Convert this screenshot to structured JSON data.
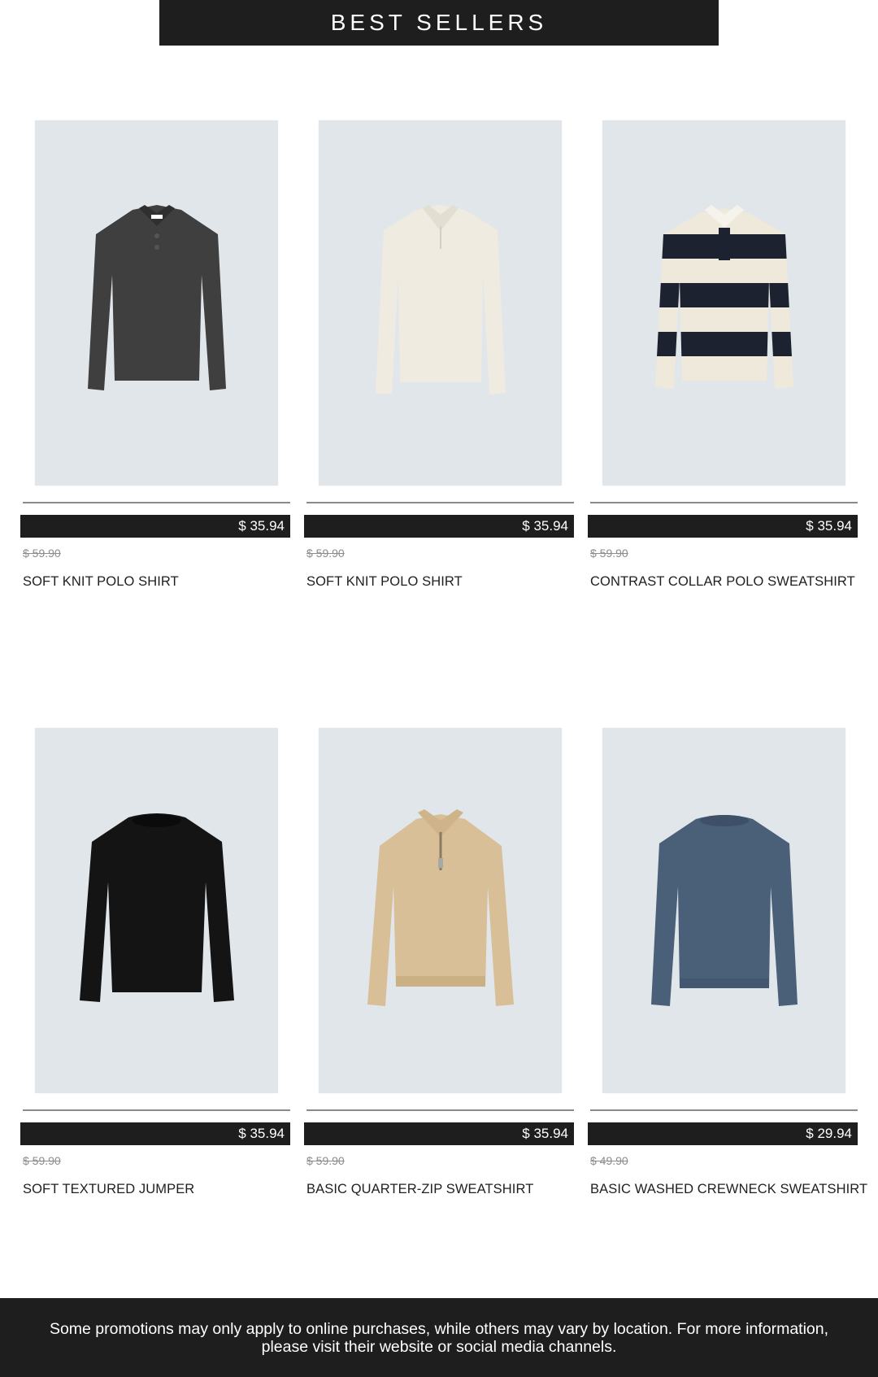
{
  "header": {
    "title": "BEST SELLERS"
  },
  "products": [
    {
      "price": "$ 35.94",
      "old_price": "$ 59.90",
      "name": "SOFT KNIT POLO SHIRT",
      "image": "knit-polo-charcoal",
      "color": "#3f3f3f"
    },
    {
      "price": "$ 35.94",
      "old_price": "$ 59.90",
      "name": "SOFT KNIT POLO SHIRT",
      "image": "knit-polo-ecru",
      "color": "#efebe1"
    },
    {
      "price": "$ 35.94",
      "old_price": "$ 59.90",
      "name": "CONTRAST COLLAR POLO SWEATSHIRT",
      "image": "striped-rugby-polo",
      "color": "#1d2230"
    },
    {
      "price": "$ 35.94",
      "old_price": "$ 59.90",
      "name": "SOFT TEXTURED JUMPER",
      "image": "black-jumper",
      "color": "#141414"
    },
    {
      "price": "$ 35.94",
      "old_price": "$ 59.90",
      "name": "BASIC QUARTER-ZIP SWEATSHIRT",
      "image": "beige-quarter-zip",
      "color": "#d8bf97"
    },
    {
      "price": "$ 29.94",
      "old_price": "$ 49.90",
      "name": "BASIC WASHED CREWNECK SWEATSHIRT",
      "image": "blue-crewneck",
      "color": "#4a5f78"
    }
  ],
  "footer": {
    "text": "Some promotions may only apply to online purchases, while others may vary by location. For more information, please visit their website or social media channels."
  }
}
